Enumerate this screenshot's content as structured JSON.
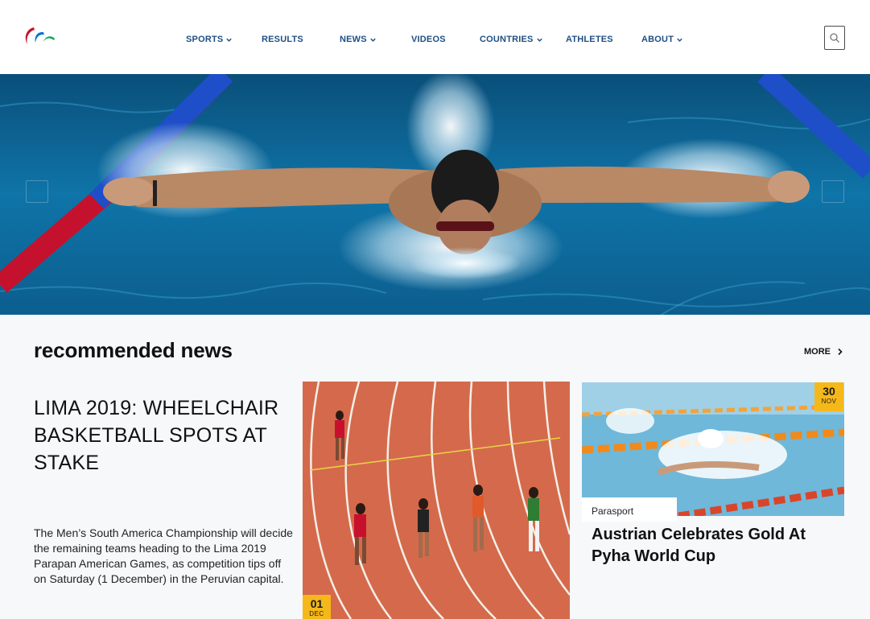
{
  "nav": {
    "items": [
      {
        "label": "SPORTS",
        "dropdown": true
      },
      {
        "label": "RESULTS",
        "dropdown": false
      },
      {
        "label": "NEWS",
        "dropdown": true
      },
      {
        "label": "VIDEOS",
        "dropdown": false
      },
      {
        "label": "COUNTRIES",
        "dropdown": true
      },
      {
        "label": "ATHLETES",
        "dropdown": false
      },
      {
        "label": "ABOUT",
        "dropdown": true
      }
    ]
  },
  "icons": {
    "logo": "agitos-logo-icon",
    "search": "search-icon",
    "chevron": "chevron-down-icon",
    "more": "chevron-right-icon"
  },
  "section": {
    "title": "recommended news",
    "more_label": "MORE"
  },
  "lead": {
    "headline": "LIMA 2019: WHEELCHAIR BASKETBALL SPOTS AT STAKE",
    "summary": "The Men’s South America Championship will decide the remaining teams heading to the Lima 2019 Parapan American Games, as competition tips off on Saturday (1 December) in the Peruvian capital."
  },
  "card_mid": {
    "day": "01",
    "month": "DEC"
  },
  "card_right": {
    "day": "30",
    "month": "NOV",
    "category": "Parasport",
    "title": "Austrian Celebrates Gold At Pyha World Cup"
  },
  "colors": {
    "nav_text": "#1f4f82",
    "badge": "#f5b81b",
    "pool": "#0f6fa3",
    "track": "#d5684a"
  }
}
